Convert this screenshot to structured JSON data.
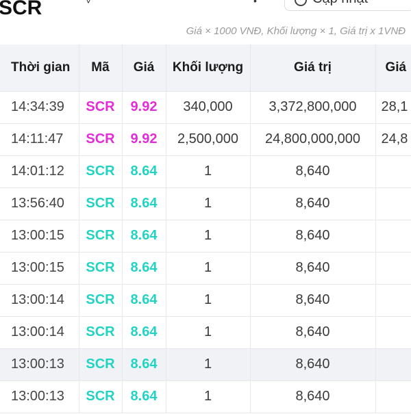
{
  "header": {
    "title": "SCR",
    "update_label": "Cập nhật",
    "note": "Giá × 1000 VNĐ, Khối lượng × 1, Giá trị x 1VNĐ"
  },
  "table": {
    "columns": [
      "Thời gian",
      "Mã",
      "Giá",
      "Khối lượng",
      "Giá trị",
      "Giá"
    ],
    "rows": [
      {
        "time": "14:34:39",
        "code": "SCR",
        "price": "9.92",
        "volume": "340,000",
        "value": "3,372,800,000",
        "extra": "28,1",
        "color": "#e32bd8"
      },
      {
        "time": "14:11:47",
        "code": "SCR",
        "price": "9.92",
        "volume": "2,500,000",
        "value": "24,800,000,000",
        "extra": "24,8",
        "color": "#e32bd8"
      },
      {
        "time": "14:01:12",
        "code": "SCR",
        "price": "8.64",
        "volume": "1",
        "value": "8,640",
        "extra": "",
        "color": "#22d3c4"
      },
      {
        "time": "13:56:40",
        "code": "SCR",
        "price": "8.64",
        "volume": "1",
        "value": "8,640",
        "extra": "",
        "color": "#22d3c4"
      },
      {
        "time": "13:00:15",
        "code": "SCR",
        "price": "8.64",
        "volume": "1",
        "value": "8,640",
        "extra": "",
        "color": "#22d3c4"
      },
      {
        "time": "13:00:15",
        "code": "SCR",
        "price": "8.64",
        "volume": "1",
        "value": "8,640",
        "extra": "",
        "color": "#22d3c4"
      },
      {
        "time": "13:00:14",
        "code": "SCR",
        "price": "8.64",
        "volume": "1",
        "value": "8,640",
        "extra": "",
        "color": "#22d3c4"
      },
      {
        "time": "13:00:14",
        "code": "SCR",
        "price": "8.64",
        "volume": "1",
        "value": "8,640",
        "extra": "",
        "color": "#22d3c4"
      },
      {
        "time": "13:00:13",
        "code": "SCR",
        "price": "8.64",
        "volume": "1",
        "value": "8,640",
        "extra": "",
        "color": "#22d3c4"
      },
      {
        "time": "13:00:13",
        "code": "SCR",
        "price": "8.64",
        "volume": "1",
        "value": "8,640",
        "extra": "",
        "color": "#22d3c4"
      }
    ],
    "highlighted_row": 8
  }
}
